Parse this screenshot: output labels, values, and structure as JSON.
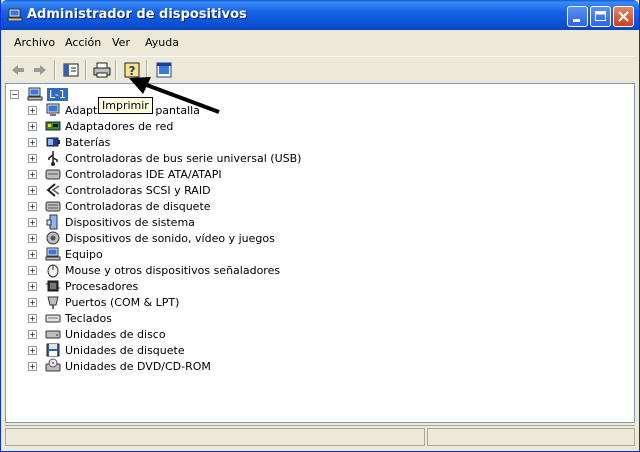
{
  "window": {
    "title": "Administrador de dispositivos"
  },
  "menu": {
    "items": [
      "Archivo",
      "Acción",
      "Ver",
      "Ayuda"
    ]
  },
  "toolbar": {
    "buttons": [
      "back-icon",
      "forward-icon",
      "show-hide-tree-icon",
      "print-icon",
      "help-icon",
      "properties-icon"
    ]
  },
  "tooltip": {
    "text": "Imprimir"
  },
  "tree": {
    "root": "L-1",
    "items": [
      {
        "label": "Adaptadores de pantalla",
        "icon": "display-adapter-icon"
      },
      {
        "label": "Adaptadores de red",
        "icon": "network-adapter-icon"
      },
      {
        "label": "Baterías",
        "icon": "battery-icon"
      },
      {
        "label": "Controladoras de bus serie universal (USB)",
        "icon": "usb-icon"
      },
      {
        "label": "Controladoras IDE ATA/ATAPI",
        "icon": "ide-icon"
      },
      {
        "label": "Controladoras SCSI y RAID",
        "icon": "scsi-icon"
      },
      {
        "label": "Controladoras de disquete",
        "icon": "floppy-controller-icon"
      },
      {
        "label": "Dispositivos de sistema",
        "icon": "system-device-icon"
      },
      {
        "label": "Dispositivos de sonido, vídeo y juegos",
        "icon": "sound-icon"
      },
      {
        "label": "Equipo",
        "icon": "computer-icon"
      },
      {
        "label": "Mouse y otros dispositivos señaladores",
        "icon": "mouse-icon"
      },
      {
        "label": "Procesadores",
        "icon": "processor-icon"
      },
      {
        "label": "Puertos (COM & LPT)",
        "icon": "port-icon"
      },
      {
        "label": "Teclados",
        "icon": "keyboard-icon"
      },
      {
        "label": "Unidades de disco",
        "icon": "disk-drive-icon"
      },
      {
        "label": "Unidades de disquete",
        "icon": "floppy-drive-icon"
      },
      {
        "label": "Unidades de DVD/CD-ROM",
        "icon": "dvd-icon"
      }
    ]
  }
}
